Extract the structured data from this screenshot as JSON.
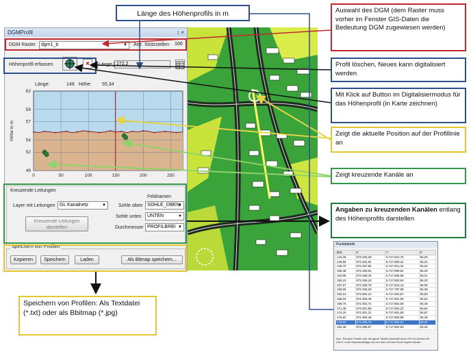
{
  "panel": {
    "title": "DGMProfil",
    "title_icons": "↕ ×",
    "dgm_label": "DGM Raster",
    "dgm_value": "dgm1_b",
    "stuetz_label": "Anz. Stützstellen",
    "stuetz_value": "100",
    "erfassen_label": "Höhenprofil erfassen",
    "laenge_label": "Länge [m]",
    "laenge_value": "272,2",
    "readout_laenge_label": "Länge:",
    "readout_laenge_value": "149",
    "readout_hoehe_label": "Höhe:",
    "readout_hoehe_value": "55,34"
  },
  "chart_data": {
    "type": "area",
    "ylabel": "Höhe in m",
    "xlim": [
      0,
      272
    ],
    "ylim": [
      49,
      62
    ],
    "xticks": [
      "0",
      "50",
      "100",
      "150",
      "200",
      "250"
    ],
    "yticks": [
      "49",
      "52",
      "54",
      "57",
      "59",
      "62"
    ],
    "profile": {
      "x": [
        0,
        10,
        20,
        30,
        40,
        50,
        60,
        70,
        80,
        90,
        100,
        110,
        120,
        130,
        140,
        150,
        160,
        170,
        180,
        190,
        200,
        210,
        220,
        230,
        240,
        250,
        260,
        272
      ],
      "y": [
        55.3,
        55.2,
        55.4,
        55.3,
        55.2,
        55.3,
        55.4,
        55.2,
        55.3,
        55.5,
        55.4,
        55.3,
        55.2,
        55.3,
        55.5,
        55.3,
        55.4,
        55.2,
        55.4,
        55.3,
        55.5,
        55.4,
        55.2,
        55.3,
        55.4,
        55.3,
        55.2,
        55.3
      ]
    },
    "current_position_x": 149,
    "crossings": [
      {
        "x": 20,
        "y": 52.0
      },
      {
        "x": 22,
        "y": 51.8
      },
      {
        "x": 24,
        "y": 51.6
      },
      {
        "x": 165,
        "y": 54.7
      },
      {
        "x": 168,
        "y": 54.4
      }
    ],
    "colors": {
      "sky": "#b9d9ec",
      "ground": "#d9b48f",
      "line": "#8a1a1a",
      "marker": "#cc2222",
      "crossing": "#2e7d2e"
    }
  },
  "kreuz": {
    "title": "Kreuzende Leitungen",
    "feldnamen": "Feldnamen",
    "layer_label": "Layer mit Leitungen",
    "layer_value": "GL Kanalnetz",
    "sohle_oben_label": "Sohle oben",
    "sohle_oben_value": "SOHLE_OBEN",
    "sohle_unten_label": "Sohle unten",
    "sohle_unten_value": "UNTEN",
    "durchmesser_label": "Durchmesser",
    "durchmesser_value": "PROFILBREI",
    "show_button_line1": "Kreuzende Leitungen",
    "show_button_line2": "darstellen"
  },
  "speichern": {
    "title": "Speichern von Profilen",
    "kopieren": "Kopieren",
    "speichern": "Speichern",
    "laden": "Laden",
    "bitmap": "Als Bitmap speichern..."
  },
  "callouts": {
    "laenge_title": "Länge des Höhenprofils in m",
    "auswahl": "Auswahl des DGM (dem Raster muss vorher im Fenster GIS-Daten die Bedeutung DGM zugewiesen werden)",
    "loeschen": "Profil löschen, Neues kann digitalisiert werden",
    "klick": "Mit Klick auf Button im Digitalisiermodus für das Höhenprofil (in Karte zeichnen)",
    "position": "Zeigt die aktuelle Position auf der Profillinie an",
    "kanaele": "Zeigt kreuzende Kanäle an",
    "angaben_bold": "Angaben zu kreuzenden Kanälen",
    "angaben_rest": "entlang des Höhenprofils darstellen",
    "speichern_info": "Speichern von Profilen: Als Textdatei (*.txt) oder als Bbitmap (*.jpg)"
  },
  "table_window": {
    "title": "Punkttabelle",
    "headers": [
      "Dist",
      "X",
      "Y",
      "Z"
    ],
    "rows": [
      [
        "144,28",
        "572.333,30",
        "5.717.812,76",
        "55,26"
      ],
      [
        "146,96",
        "572.331,94",
        "5.717.800,41",
        "55,24"
      ],
      [
        "149,70",
        "572.327,85",
        "5.717.811,34",
        "55,24"
      ],
      [
        "150,48",
        "572.330,64",
        "5.717.808,64",
        "55,29"
      ],
      [
        "154,98",
        "572.328,44",
        "5.717.806,56",
        "55,31"
      ],
      [
        "155,15",
        "572.326,43",
        "5.717.802,53",
        "55,33"
      ],
      [
        "157,57",
        "572.325,76",
        "5.717.813,13",
        "55,36"
      ],
      [
        "160,59",
        "572.326,33",
        "5.717.797,98",
        "55,38"
      ],
      [
        "163,31",
        "572.304,21",
        "5.717.804,57",
        "55,53"
      ],
      [
        "166,03",
        "572.303,48",
        "5.717.801,60",
        "55,54"
      ],
      [
        "168,76",
        "572.302,71",
        "5.717.801,00",
        "55,45"
      ],
      [
        "171,48",
        "572.301,96",
        "5.717.804,22",
        "55,54"
      ],
      [
        "174,20",
        "572.301,21",
        "5.717.801,83",
        "55,57"
      ],
      [
        "176,92",
        "572.300,45",
        "5.717.803,89",
        "55,48"
      ],
      [
        "179,64",
        "572.299,70",
        "5.717.802,07",
        "55,40"
      ],
      [
        "182,36",
        "572.298,97",
        "5.717.804,83",
        "55,36"
      ]
    ],
    "footer": "Ans.: Einzelne Punkte oder die ganze Tabelle (Auswahl durch Ctrl+A) können mit Ctrl+C in die Zwischenablage und von dort z.B nach Excel kopiert werden"
  }
}
